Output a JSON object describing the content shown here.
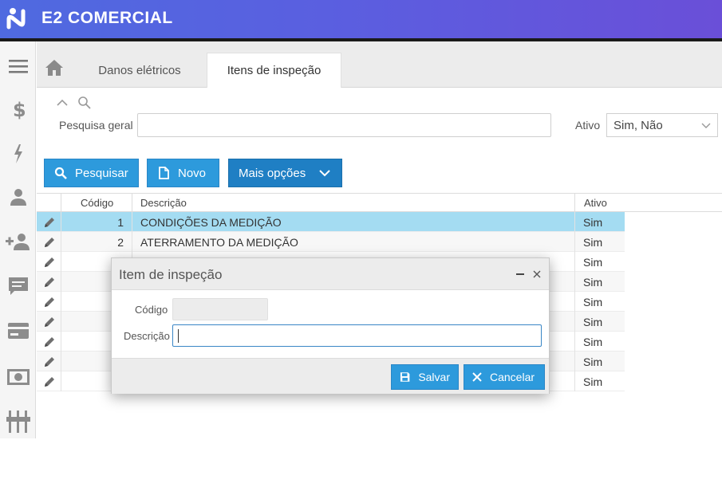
{
  "header": {
    "brand": "E2 COMERCIAL"
  },
  "tabs": [
    {
      "label": "Danos elétricos",
      "active": false
    },
    {
      "label": "Itens de inspeção",
      "active": true
    }
  ],
  "search": {
    "label": "Pesquisa geral",
    "value": "",
    "ativo_label": "Ativo",
    "ativo_value": "Sim, Não"
  },
  "toolbar": {
    "search_label": "Pesquisar",
    "new_label": "Novo",
    "more_label": "Mais opções"
  },
  "grid": {
    "columns": [
      "Código",
      "Descrição",
      "Ativo"
    ],
    "rows": [
      {
        "codigo": "1",
        "descricao": "CONDIÇÕES DA MEDIÇÃO",
        "ativo": "Sim",
        "selected": true
      },
      {
        "codigo": "2",
        "descricao": "ATERRAMENTO DA MEDIÇÃO",
        "ativo": "Sim"
      },
      {
        "codigo": "",
        "descricao": "",
        "ativo": "Sim"
      },
      {
        "codigo": "",
        "descricao": "",
        "ativo": "Sim"
      },
      {
        "codigo": "",
        "descricao": "",
        "ativo": "Sim"
      },
      {
        "codigo": "",
        "descricao": "",
        "ativo": "Sim"
      },
      {
        "codigo": "",
        "descricao": "",
        "ativo": "Sim"
      },
      {
        "codigo": "",
        "descricao": "",
        "ativo": "Sim"
      },
      {
        "codigo": "",
        "descricao": "",
        "ativo": "Sim"
      }
    ]
  },
  "modal": {
    "title": "Item de inspeção",
    "codigo_label": "Código",
    "codigo_value": "",
    "descricao_label": "Descrição",
    "descricao_value": "",
    "save_label": "Salvar",
    "cancel_label": "Cancelar"
  },
  "sidebar": {
    "icons": [
      "menu-icon",
      "dollar-icon",
      "lightning-icon",
      "user-icon",
      "add-user-icon",
      "chat-icon",
      "card-icon",
      "money-icon",
      "sliders-icon"
    ]
  },
  "colors": {
    "accent": "#2d9adc",
    "selected_row": "#a4dcf2",
    "header_gradient_start": "#4f6ae0",
    "header_gradient_end": "#6a4fd8"
  }
}
